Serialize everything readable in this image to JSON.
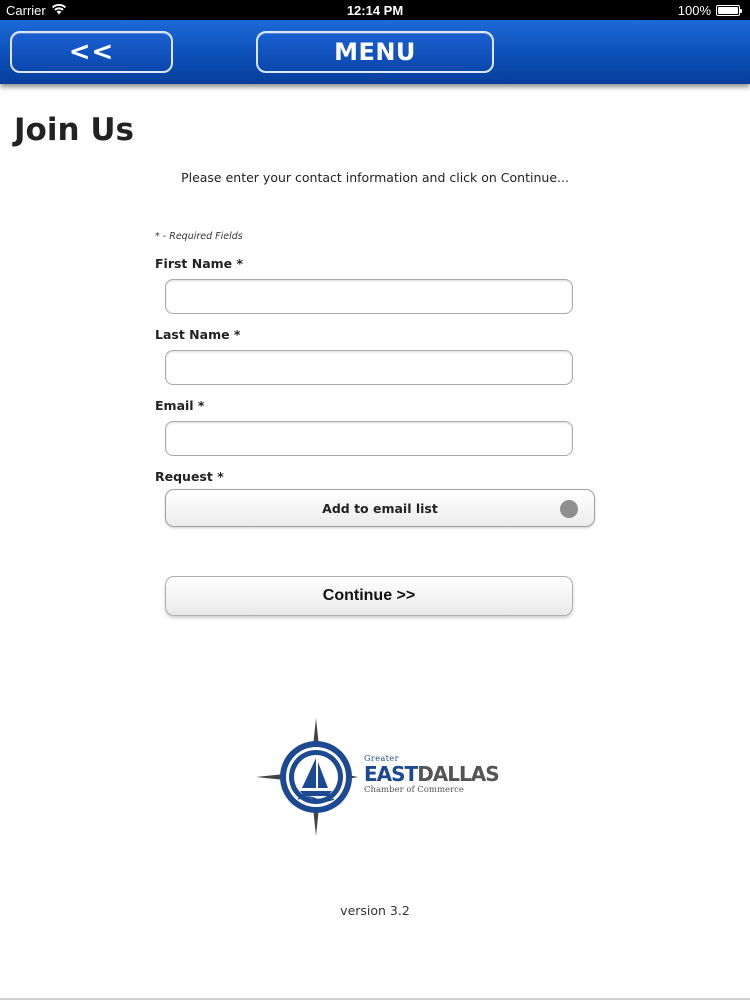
{
  "status_bar": {
    "carrier": "Carrier",
    "time": "12:14 PM",
    "battery_percent": "100%",
    "battery_level": 1.0,
    "icons": [
      "wifi-icon",
      "battery-icon"
    ]
  },
  "nav": {
    "back_label": "<<",
    "menu_label": "MENU"
  },
  "page": {
    "title": "Join Us",
    "intro": "Please enter your contact information and click on Continue...",
    "required_note": "* - Required Fields"
  },
  "form": {
    "first_name": {
      "label": "First Name *",
      "value": "",
      "placeholder": ""
    },
    "last_name": {
      "label": "Last Name *",
      "value": "",
      "placeholder": ""
    },
    "email": {
      "label": "Email *",
      "value": "",
      "placeholder": ""
    },
    "request": {
      "label": "Request *",
      "selected": "Add to email list"
    },
    "continue_label": "Continue >>"
  },
  "logo": {
    "greater": "Greater",
    "east": "EAST",
    "dallas": "DALLAS",
    "chamber": "Chamber of Commerce"
  },
  "footer": {
    "version": "version 3.2"
  },
  "colors": {
    "nav_blue": "#0c4fb8",
    "brand_blue": "#1b4a92",
    "select_indicator": "#8e8e8e"
  }
}
